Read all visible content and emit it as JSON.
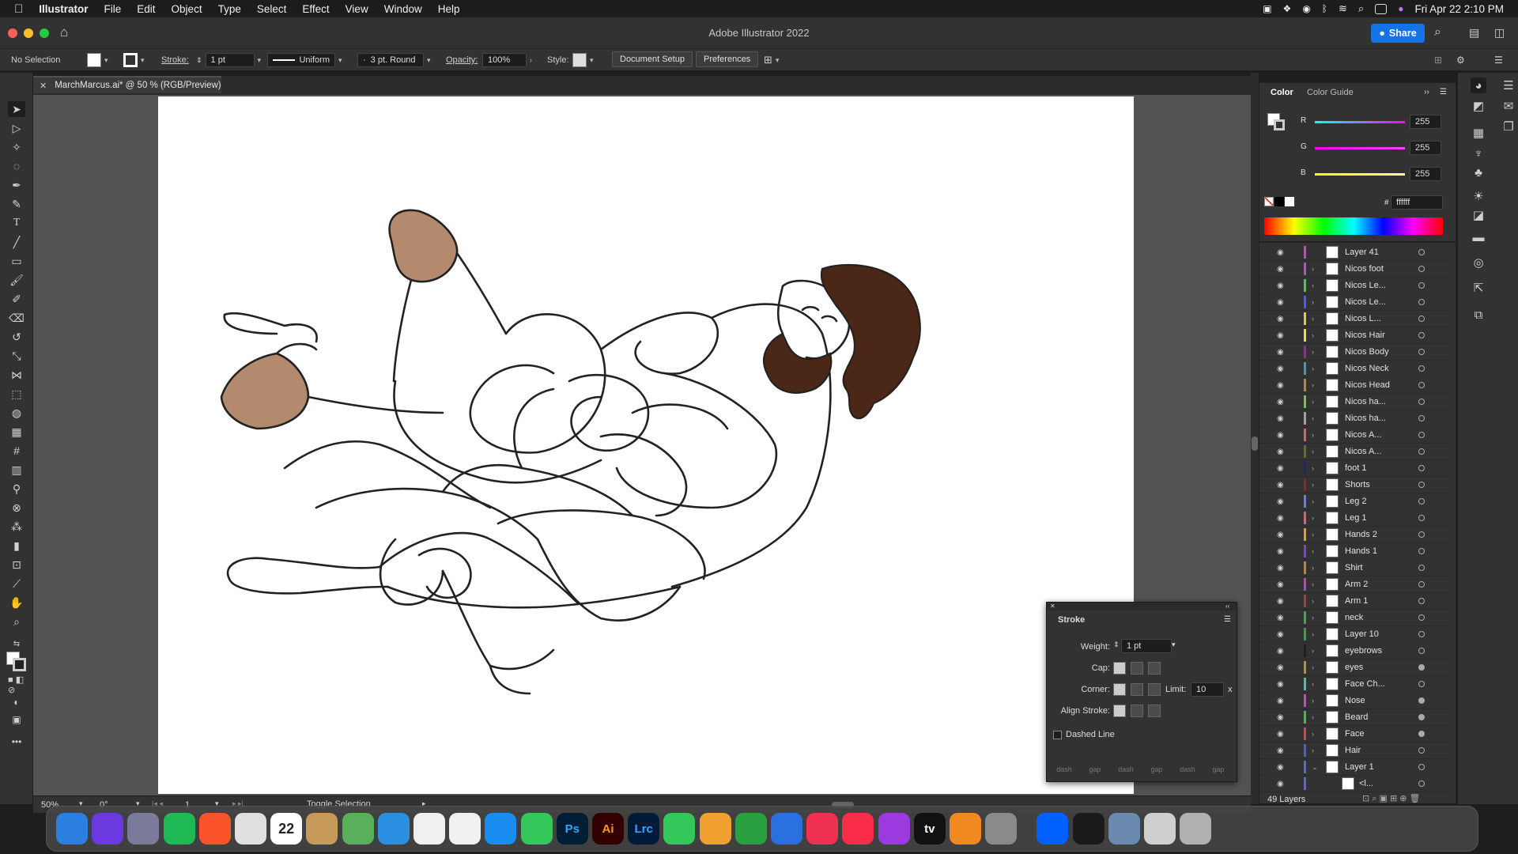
{
  "menubar": {
    "app": "Illustrator",
    "items": [
      "File",
      "Edit",
      "Object",
      "Type",
      "Select",
      "Effect",
      "View",
      "Window",
      "Help"
    ],
    "datetime": "Fri Apr 22  2:10 PM"
  },
  "window": {
    "title": "Adobe Illustrator 2022",
    "share_label": "Share"
  },
  "controlbar": {
    "selection": "No Selection",
    "stroke_label": "Stroke:",
    "stroke_value": "1 pt",
    "profile": "Uniform",
    "brush": "3 pt. Round",
    "opacity_label": "Opacity:",
    "opacity_value": "100%",
    "style_label": "Style:",
    "document_setup": "Document Setup",
    "preferences": "Preferences"
  },
  "document": {
    "tab_title": "MarchMarcus.ai* @ 50 % (RGB/Preview)"
  },
  "statusbar": {
    "zoom": "50%",
    "rotation": "0°",
    "artboard": "1",
    "info": "Toggle Selection"
  },
  "color_panel": {
    "tab_color": "Color",
    "tab_guide": "Color Guide",
    "r_label": "R",
    "r_value": "255",
    "g_label": "G",
    "g_value": "255",
    "b_label": "B",
    "b_value": "255",
    "hash": "#",
    "hex": "ffffff",
    "colors": {
      "r": "#e0285a",
      "g": "#e020e0",
      "b": "#e8e000"
    }
  },
  "layers_panel": {
    "count": "49 Layers",
    "layers": [
      {
        "name": "Layer 41",
        "color": "#d040d0",
        "expand": "",
        "target": false
      },
      {
        "name": "Nicos foot",
        "color": "#d040d0",
        "expand": "›",
        "target": false
      },
      {
        "name": "Nicos Le...",
        "color": "#40d040",
        "expand": "›",
        "target": false
      },
      {
        "name": "Nicos Le...",
        "color": "#4060ff",
        "expand": "›",
        "target": false
      },
      {
        "name": "Nicos L...",
        "color": "#d0d040",
        "expand": "›",
        "target": false
      },
      {
        "name": "Nicos Hair",
        "color": "#e0e040",
        "expand": "›",
        "target": false
      },
      {
        "name": "Nicos Body",
        "color": "#a020a0",
        "expand": "›",
        "target": false
      },
      {
        "name": "Nicos Neck",
        "color": "#40a0a0",
        "expand": "›",
        "target": false
      },
      {
        "name": "Nicos Head",
        "color": "#c08040",
        "expand": "›",
        "target": false
      },
      {
        "name": "Nicos ha...",
        "color": "#80c040",
        "expand": "›",
        "target": false
      },
      {
        "name": "Nicos ha...",
        "color": "#a0a0a0",
        "expand": "›",
        "target": false
      },
      {
        "name": "Nicos A...",
        "color": "#e06060",
        "expand": "›",
        "target": false
      },
      {
        "name": "Nicos A...",
        "color": "#607020",
        "expand": "›",
        "target": false
      },
      {
        "name": "foot 1",
        "color": "#202080",
        "expand": "›",
        "target": false
      },
      {
        "name": "Shorts",
        "color": "#a02020",
        "expand": "›",
        "target": false
      },
      {
        "name": "Leg 2",
        "color": "#6080e0",
        "expand": "›",
        "target": false
      },
      {
        "name": "Leg 1",
        "color": "#e06060",
        "expand": "›",
        "target": false
      },
      {
        "name": "Hands 2",
        "color": "#e0a020",
        "expand": "›",
        "target": false
      },
      {
        "name": "Hands 1",
        "color": "#8040e0",
        "expand": "›",
        "target": false
      },
      {
        "name": "Shirt",
        "color": "#c08040",
        "expand": "›",
        "target": false
      },
      {
        "name": "Arm 2",
        "color": "#c040c0",
        "expand": "›",
        "target": false
      },
      {
        "name": "Arm 1",
        "color": "#a04040",
        "expand": "›",
        "target": false
      },
      {
        "name": "neck",
        "color": "#40a060",
        "expand": "›",
        "target": false
      },
      {
        "name": "Layer 10",
        "color": "#40a040",
        "expand": "›",
        "target": false
      },
      {
        "name": "eyebrows",
        "color": "#202020",
        "expand": "›",
        "target": false
      },
      {
        "name": "eyes",
        "color": "#a0a020",
        "expand": "›",
        "target": true
      },
      {
        "name": "Face Ch...",
        "color": "#40c0c0",
        "expand": "›",
        "target": false
      },
      {
        "name": "Nose",
        "color": "#d040d0",
        "expand": "›",
        "target": true
      },
      {
        "name": "Beard",
        "color": "#40c040",
        "expand": "›",
        "target": true
      },
      {
        "name": "Face",
        "color": "#e04040",
        "expand": "›",
        "target": true
      },
      {
        "name": "Hair",
        "color": "#4060e0",
        "expand": "›",
        "target": false
      },
      {
        "name": "Layer 1",
        "color": "#6060e0",
        "expand": "⌄",
        "target": false
      },
      {
        "name": "<l...",
        "color": "#6060e0",
        "expand": "",
        "target": false
      }
    ]
  },
  "stroke_panel": {
    "title": "Stroke",
    "weight_label": "Weight:",
    "weight_value": "1 pt",
    "cap_label": "Cap:",
    "corner_label": "Corner:",
    "limit_label": "Limit:",
    "limit_value": "10",
    "limit_x": "x",
    "align_label": "Align Stroke:",
    "dashed_label": "Dashed Line",
    "dash_fields": [
      "dash",
      "gap",
      "dash",
      "gap",
      "dash",
      "gap"
    ]
  },
  "dock": {
    "apps": [
      {
        "name": "Finder",
        "color": "#2a7fe0",
        "glyph": ""
      },
      {
        "name": "Siri",
        "color": "#6a3ae0",
        "glyph": ""
      },
      {
        "name": "Launchpad",
        "color": "#7a7a9a",
        "glyph": ""
      },
      {
        "name": "Spotify",
        "color": "#1db954",
        "glyph": ""
      },
      {
        "name": "Brave",
        "color": "#fb542b",
        "glyph": ""
      },
      {
        "name": "Chrome",
        "color": "#e0e0e0",
        "glyph": ""
      },
      {
        "name": "Calendar",
        "color": "#ffffff",
        "glyph": "22"
      },
      {
        "name": "Contacts",
        "color": "#c89a5a",
        "glyph": ""
      },
      {
        "name": "Maps",
        "color": "#5ab05a",
        "glyph": ""
      },
      {
        "name": "Safari",
        "color": "#2a8fe0",
        "glyph": ""
      },
      {
        "name": "Photos",
        "color": "#f0f0f0",
        "glyph": ""
      },
      {
        "name": "Reminders",
        "color": "#f0f0f0",
        "glyph": ""
      },
      {
        "name": "App Store",
        "color": "#1a8ef0",
        "glyph": ""
      },
      {
        "name": "Messages",
        "color": "#34c759",
        "glyph": ""
      },
      {
        "name": "Photoshop",
        "color": "#001e36",
        "glyph": "Ps"
      },
      {
        "name": "Illustrator",
        "color": "#330000",
        "glyph": "Ai"
      },
      {
        "name": "Lightroom Classic",
        "color": "#001a3a",
        "glyph": "Lrc"
      },
      {
        "name": "FaceTime",
        "color": "#34c759",
        "glyph": ""
      },
      {
        "name": "Pages",
        "color": "#f0a030",
        "glyph": ""
      },
      {
        "name": "Numbers",
        "color": "#2aa040",
        "glyph": ""
      },
      {
        "name": "Keynote",
        "color": "#2a70e0",
        "glyph": ""
      },
      {
        "name": "News",
        "color": "#f03050",
        "glyph": ""
      },
      {
        "name": "Music",
        "color": "#fa2d48",
        "glyph": ""
      },
      {
        "name": "Podcasts",
        "color": "#9a3ae0",
        "glyph": ""
      },
      {
        "name": "TV",
        "color": "#111111",
        "glyph": "tv"
      },
      {
        "name": "Books",
        "color": "#f08a20",
        "glyph": ""
      },
      {
        "name": "System Preferences",
        "color": "#8a8a8a",
        "glyph": ""
      },
      {
        "name": "Dropbox",
        "color": "#0061fe",
        "glyph": ""
      },
      {
        "name": "Activity Monitor",
        "color": "#1a1a1a",
        "glyph": ""
      },
      {
        "name": "Preview",
        "color": "#6a8ab0",
        "glyph": ""
      },
      {
        "name": "Downloads",
        "color": "#cfcfcf",
        "glyph": ""
      },
      {
        "name": "Trash",
        "color": "#b0b0b0",
        "glyph": ""
      }
    ]
  },
  "art_colors": {
    "skin": "#b38a6e",
    "hair": "#4a2716",
    "line": "#222222"
  }
}
